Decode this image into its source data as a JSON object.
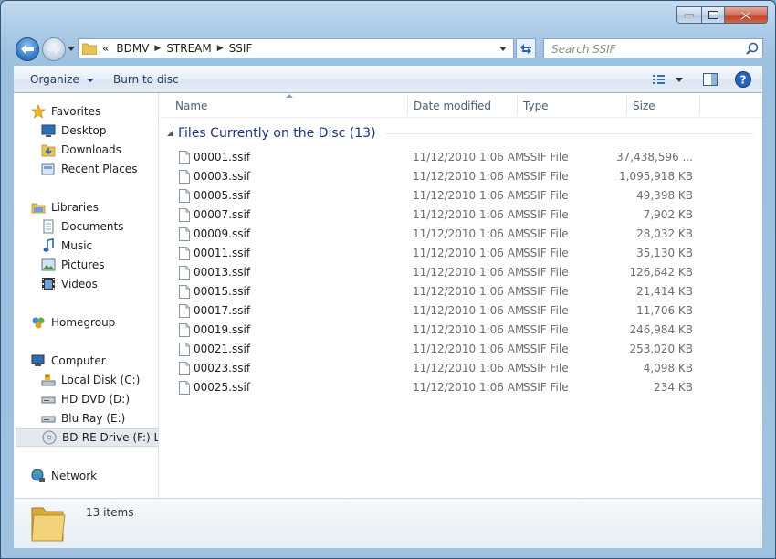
{
  "window": {
    "caption_buttons": {
      "minimize": "minimize",
      "maximize": "maximize",
      "close": "close"
    }
  },
  "address": {
    "overflow": "«",
    "crumbs": [
      "BDMV",
      "STREAM",
      "SSIF"
    ]
  },
  "search": {
    "placeholder": "Search SSIF"
  },
  "toolbar": {
    "organize": "Organize",
    "burn": "Burn to disc"
  },
  "nav": {
    "favorites": "Favorites",
    "desktop": "Desktop",
    "downloads": "Downloads",
    "recent": "Recent Places",
    "libraries": "Libraries",
    "documents": "Documents",
    "music": "Music",
    "pictures": "Pictures",
    "videos": "Videos",
    "homegroup": "Homegroup",
    "computer": "Computer",
    "local_disk": "Local Disk (C:)",
    "hddvd": "HD DVD (D:)",
    "bluray": "Blu Ray (E:)",
    "bdre": "BD-RE Drive (F:) LEGO",
    "network": "Network"
  },
  "columns": {
    "name": "Name",
    "date": "Date modified",
    "type": "Type",
    "size": "Size"
  },
  "group": {
    "title": "Files Currently on the Disc (13)"
  },
  "files": [
    {
      "name": "00001.ssif",
      "date": "11/12/2010 1:06 AM",
      "type": "SSIF File",
      "size": "37,438,596 ..."
    },
    {
      "name": "00003.ssif",
      "date": "11/12/2010 1:06 AM",
      "type": "SSIF File",
      "size": "1,095,918 KB"
    },
    {
      "name": "00005.ssif",
      "date": "11/12/2010 1:06 AM",
      "type": "SSIF File",
      "size": "49,398 KB"
    },
    {
      "name": "00007.ssif",
      "date": "11/12/2010 1:06 AM",
      "type": "SSIF File",
      "size": "7,902 KB"
    },
    {
      "name": "00009.ssif",
      "date": "11/12/2010 1:06 AM",
      "type": "SSIF File",
      "size": "28,032 KB"
    },
    {
      "name": "00011.ssif",
      "date": "11/12/2010 1:06 AM",
      "type": "SSIF File",
      "size": "35,130 KB"
    },
    {
      "name": "00013.ssif",
      "date": "11/12/2010 1:06 AM",
      "type": "SSIF File",
      "size": "126,642 KB"
    },
    {
      "name": "00015.ssif",
      "date": "11/12/2010 1:06 AM",
      "type": "SSIF File",
      "size": "21,414 KB"
    },
    {
      "name": "00017.ssif",
      "date": "11/12/2010 1:06 AM",
      "type": "SSIF File",
      "size": "11,706 KB"
    },
    {
      "name": "00019.ssif",
      "date": "11/12/2010 1:06 AM",
      "type": "SSIF File",
      "size": "246,984 KB"
    },
    {
      "name": "00021.ssif",
      "date": "11/12/2010 1:06 AM",
      "type": "SSIF File",
      "size": "253,020 KB"
    },
    {
      "name": "00023.ssif",
      "date": "11/12/2010 1:06 AM",
      "type": "SSIF File",
      "size": "4,098 KB"
    },
    {
      "name": "00025.ssif",
      "date": "11/12/2010 1:06 AM",
      "type": "SSIF File",
      "size": "234 KB"
    }
  ],
  "details": {
    "count": "13 items"
  },
  "colors": {
    "accent": "#1e3287",
    "window_frame": "#9fc2e1",
    "selection": "#e3e9ef"
  }
}
